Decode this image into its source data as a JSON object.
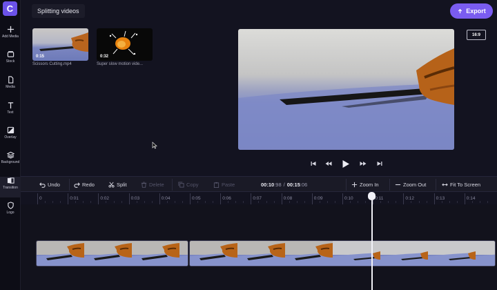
{
  "app": {
    "logo": "C",
    "project_title": "Splitting videos",
    "export_label": "Export"
  },
  "sidebar": {
    "items": [
      {
        "label": "Add Media",
        "icon": "plus-icon"
      },
      {
        "label": "Stock",
        "icon": "stock-icon"
      },
      {
        "label": "Media",
        "icon": "file-icon"
      },
      {
        "label": "Text",
        "icon": "text-icon"
      },
      {
        "label": "Overlay",
        "icon": "overlay-icon"
      },
      {
        "label": "Background",
        "icon": "layers-icon"
      },
      {
        "label": "Transition",
        "icon": "transition-icon"
      },
      {
        "label": "Logo",
        "icon": "shield-icon"
      }
    ],
    "active": "Transition"
  },
  "media": [
    {
      "duration": "0:15",
      "name": "Scissors Cutting.mp4"
    },
    {
      "duration": "0:32",
      "name": "Super slow motion vide..."
    }
  ],
  "preview": {
    "aspect_ratio": "16:9"
  },
  "toolbar": {
    "undo": "Undo",
    "redo": "Redo",
    "split": "Split",
    "delete": "Delete",
    "copy": "Copy",
    "paste": "Paste",
    "current_time_main": "00:10",
    "current_time_frac": ":98",
    "separator": "/",
    "total_time_main": "00:15",
    "total_time_frac": ":06",
    "zoom_in": "Zoom In",
    "zoom_out": "Zoom Out",
    "fit": "Fit To Screen"
  },
  "ruler": {
    "labels": [
      "0",
      "0:01",
      "0:02",
      "0:03",
      "0:04",
      "0:05",
      "0:06",
      "0:07",
      "0:08",
      "0:09",
      "0:10",
      "0:11",
      "0:12",
      "0:13",
      "0:14"
    ]
  },
  "colors": {
    "accent": "#7a5cf0",
    "logo": "#6b52e8",
    "background": "#131320"
  }
}
